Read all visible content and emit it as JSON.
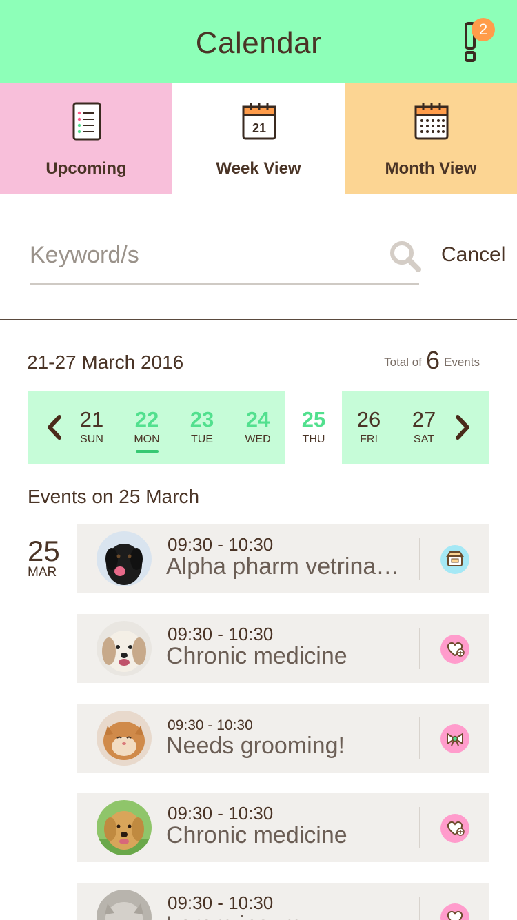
{
  "header": {
    "title": "Calendar",
    "alert_count": "2"
  },
  "tabs": [
    {
      "label": "Upcoming",
      "icon": "list-icon"
    },
    {
      "label": "Week View",
      "icon": "calendar-day-icon",
      "icon_text": "21"
    },
    {
      "label": "Month View",
      "icon": "calendar-month-icon"
    }
  ],
  "search": {
    "placeholder": "Keyword/s",
    "cancel_label": "Cancel"
  },
  "week": {
    "range": "21-27 March 2016",
    "total_prefix": "Total of",
    "total_count": "6",
    "total_suffix": "Events",
    "days": [
      {
        "num": "21",
        "name": "SUN"
      },
      {
        "num": "22",
        "name": "MON"
      },
      {
        "num": "23",
        "name": "TUE"
      },
      {
        "num": "24",
        "name": "WED"
      },
      {
        "num": "25",
        "name": "THU"
      },
      {
        "num": "26",
        "name": "FRI"
      },
      {
        "num": "27",
        "name": "SAT"
      }
    ]
  },
  "events": {
    "heading": "Events on 25 March",
    "date_num": "25",
    "date_month": "MAR",
    "items": [
      {
        "time": "09:30 - 10:30",
        "title": "Alpha pharm vetrinary clinic",
        "category_icon": "store-icon"
      },
      {
        "time": "09:30 - 10:30",
        "title": "Chronic medicine",
        "category_icon": "heart-plus-icon"
      },
      {
        "time": "09:30 - 10:30",
        "title": "Needs grooming!",
        "category_icon": "bow-icon"
      },
      {
        "time": "09:30 - 10:30",
        "title": "Chronic medicine",
        "category_icon": "heart-plus-icon"
      },
      {
        "time": "09:30 - 10:30",
        "title": "Lorem ipsum",
        "category_icon": "heart-plus-icon"
      }
    ]
  },
  "colors": {
    "header_bg": "#8dffb8",
    "tab_upcoming": "#f8bfda",
    "tab_month": "#fcd593",
    "accent_green": "#52e08e",
    "badge": "#ff9c4a",
    "text_brown": "#4a3426"
  }
}
